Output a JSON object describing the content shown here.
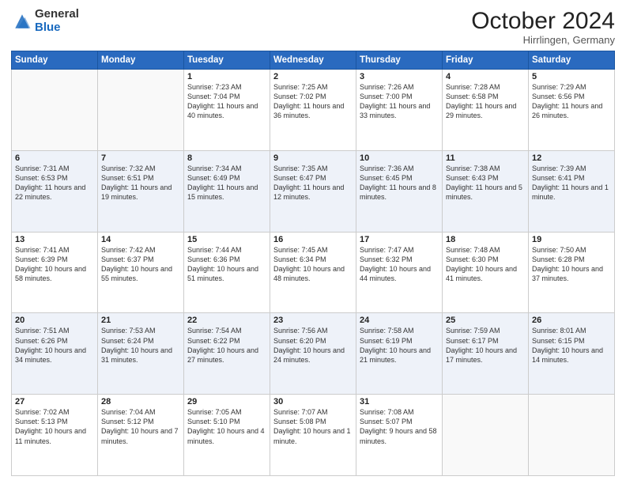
{
  "header": {
    "logo_general": "General",
    "logo_blue": "Blue",
    "month": "October 2024",
    "location": "Hirrlingen, Germany"
  },
  "weekdays": [
    "Sunday",
    "Monday",
    "Tuesday",
    "Wednesday",
    "Thursday",
    "Friday",
    "Saturday"
  ],
  "weeks": [
    [
      {
        "day": "",
        "sunrise": "",
        "sunset": "",
        "daylight": ""
      },
      {
        "day": "",
        "sunrise": "",
        "sunset": "",
        "daylight": ""
      },
      {
        "day": "1",
        "sunrise": "Sunrise: 7:23 AM",
        "sunset": "Sunset: 7:04 PM",
        "daylight": "Daylight: 11 hours and 40 minutes."
      },
      {
        "day": "2",
        "sunrise": "Sunrise: 7:25 AM",
        "sunset": "Sunset: 7:02 PM",
        "daylight": "Daylight: 11 hours and 36 minutes."
      },
      {
        "day": "3",
        "sunrise": "Sunrise: 7:26 AM",
        "sunset": "Sunset: 7:00 PM",
        "daylight": "Daylight: 11 hours and 33 minutes."
      },
      {
        "day": "4",
        "sunrise": "Sunrise: 7:28 AM",
        "sunset": "Sunset: 6:58 PM",
        "daylight": "Daylight: 11 hours and 29 minutes."
      },
      {
        "day": "5",
        "sunrise": "Sunrise: 7:29 AM",
        "sunset": "Sunset: 6:56 PM",
        "daylight": "Daylight: 11 hours and 26 minutes."
      }
    ],
    [
      {
        "day": "6",
        "sunrise": "Sunrise: 7:31 AM",
        "sunset": "Sunset: 6:53 PM",
        "daylight": "Daylight: 11 hours and 22 minutes."
      },
      {
        "day": "7",
        "sunrise": "Sunrise: 7:32 AM",
        "sunset": "Sunset: 6:51 PM",
        "daylight": "Daylight: 11 hours and 19 minutes."
      },
      {
        "day": "8",
        "sunrise": "Sunrise: 7:34 AM",
        "sunset": "Sunset: 6:49 PM",
        "daylight": "Daylight: 11 hours and 15 minutes."
      },
      {
        "day": "9",
        "sunrise": "Sunrise: 7:35 AM",
        "sunset": "Sunset: 6:47 PM",
        "daylight": "Daylight: 11 hours and 12 minutes."
      },
      {
        "day": "10",
        "sunrise": "Sunrise: 7:36 AM",
        "sunset": "Sunset: 6:45 PM",
        "daylight": "Daylight: 11 hours and 8 minutes."
      },
      {
        "day": "11",
        "sunrise": "Sunrise: 7:38 AM",
        "sunset": "Sunset: 6:43 PM",
        "daylight": "Daylight: 11 hours and 5 minutes."
      },
      {
        "day": "12",
        "sunrise": "Sunrise: 7:39 AM",
        "sunset": "Sunset: 6:41 PM",
        "daylight": "Daylight: 11 hours and 1 minute."
      }
    ],
    [
      {
        "day": "13",
        "sunrise": "Sunrise: 7:41 AM",
        "sunset": "Sunset: 6:39 PM",
        "daylight": "Daylight: 10 hours and 58 minutes."
      },
      {
        "day": "14",
        "sunrise": "Sunrise: 7:42 AM",
        "sunset": "Sunset: 6:37 PM",
        "daylight": "Daylight: 10 hours and 55 minutes."
      },
      {
        "day": "15",
        "sunrise": "Sunrise: 7:44 AM",
        "sunset": "Sunset: 6:36 PM",
        "daylight": "Daylight: 10 hours and 51 minutes."
      },
      {
        "day": "16",
        "sunrise": "Sunrise: 7:45 AM",
        "sunset": "Sunset: 6:34 PM",
        "daylight": "Daylight: 10 hours and 48 minutes."
      },
      {
        "day": "17",
        "sunrise": "Sunrise: 7:47 AM",
        "sunset": "Sunset: 6:32 PM",
        "daylight": "Daylight: 10 hours and 44 minutes."
      },
      {
        "day": "18",
        "sunrise": "Sunrise: 7:48 AM",
        "sunset": "Sunset: 6:30 PM",
        "daylight": "Daylight: 10 hours and 41 minutes."
      },
      {
        "day": "19",
        "sunrise": "Sunrise: 7:50 AM",
        "sunset": "Sunset: 6:28 PM",
        "daylight": "Daylight: 10 hours and 37 minutes."
      }
    ],
    [
      {
        "day": "20",
        "sunrise": "Sunrise: 7:51 AM",
        "sunset": "Sunset: 6:26 PM",
        "daylight": "Daylight: 10 hours and 34 minutes."
      },
      {
        "day": "21",
        "sunrise": "Sunrise: 7:53 AM",
        "sunset": "Sunset: 6:24 PM",
        "daylight": "Daylight: 10 hours and 31 minutes."
      },
      {
        "day": "22",
        "sunrise": "Sunrise: 7:54 AM",
        "sunset": "Sunset: 6:22 PM",
        "daylight": "Daylight: 10 hours and 27 minutes."
      },
      {
        "day": "23",
        "sunrise": "Sunrise: 7:56 AM",
        "sunset": "Sunset: 6:20 PM",
        "daylight": "Daylight: 10 hours and 24 minutes."
      },
      {
        "day": "24",
        "sunrise": "Sunrise: 7:58 AM",
        "sunset": "Sunset: 6:19 PM",
        "daylight": "Daylight: 10 hours and 21 minutes."
      },
      {
        "day": "25",
        "sunrise": "Sunrise: 7:59 AM",
        "sunset": "Sunset: 6:17 PM",
        "daylight": "Daylight: 10 hours and 17 minutes."
      },
      {
        "day": "26",
        "sunrise": "Sunrise: 8:01 AM",
        "sunset": "Sunset: 6:15 PM",
        "daylight": "Daylight: 10 hours and 14 minutes."
      }
    ],
    [
      {
        "day": "27",
        "sunrise": "Sunrise: 7:02 AM",
        "sunset": "Sunset: 5:13 PM",
        "daylight": "Daylight: 10 hours and 11 minutes."
      },
      {
        "day": "28",
        "sunrise": "Sunrise: 7:04 AM",
        "sunset": "Sunset: 5:12 PM",
        "daylight": "Daylight: 10 hours and 7 minutes."
      },
      {
        "day": "29",
        "sunrise": "Sunrise: 7:05 AM",
        "sunset": "Sunset: 5:10 PM",
        "daylight": "Daylight: 10 hours and 4 minutes."
      },
      {
        "day": "30",
        "sunrise": "Sunrise: 7:07 AM",
        "sunset": "Sunset: 5:08 PM",
        "daylight": "Daylight: 10 hours and 1 minute."
      },
      {
        "day": "31",
        "sunrise": "Sunrise: 7:08 AM",
        "sunset": "Sunset: 5:07 PM",
        "daylight": "Daylight: 9 hours and 58 minutes."
      },
      {
        "day": "",
        "sunrise": "",
        "sunset": "",
        "daylight": ""
      },
      {
        "day": "",
        "sunrise": "",
        "sunset": "",
        "daylight": ""
      }
    ]
  ]
}
